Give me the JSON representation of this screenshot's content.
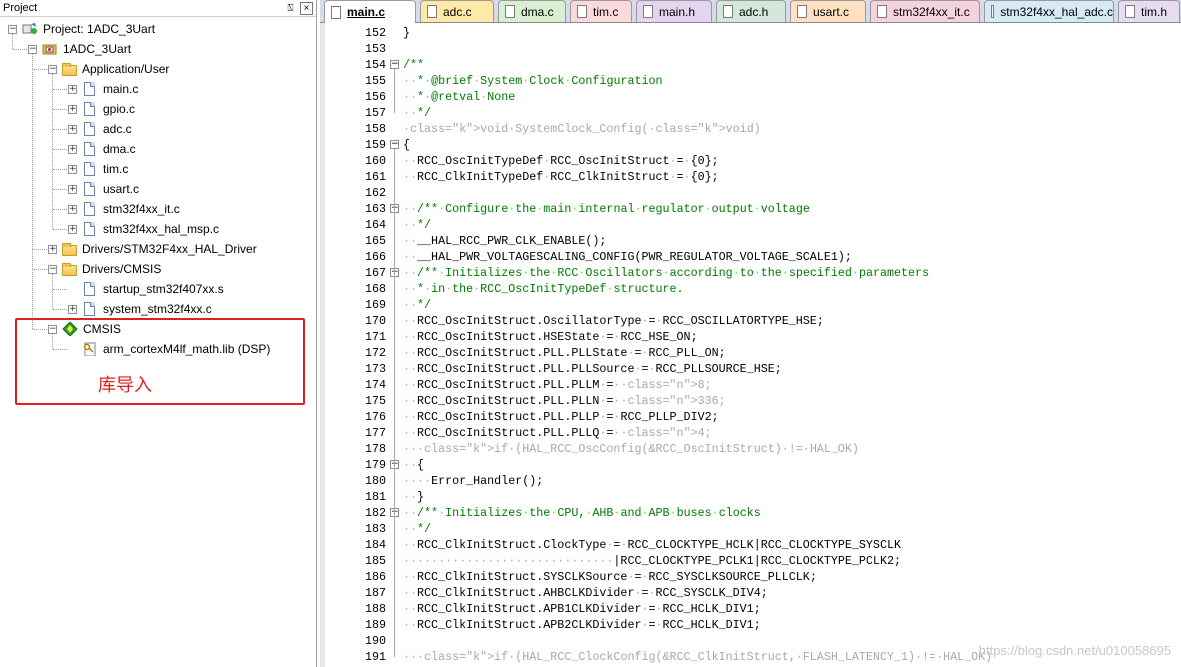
{
  "panel": {
    "title": "Project",
    "pin_glyph": "⍂",
    "close_glyph": "×"
  },
  "tree": [
    {
      "label": "Project: 1ADC_3Uart",
      "icon": "project-icon",
      "expander": "−",
      "depth": 0
    },
    {
      "label": "1ADC_3Uart",
      "icon": "target-icon",
      "expander": "−",
      "depth": 1
    },
    {
      "label": "Application/User",
      "icon": "folder-open-icon",
      "expander": "−",
      "depth": 2
    },
    {
      "label": "main.c",
      "icon": "file-icon",
      "expander": "+",
      "depth": 3
    },
    {
      "label": "gpio.c",
      "icon": "file-icon",
      "expander": "+",
      "depth": 3
    },
    {
      "label": "adc.c",
      "icon": "file-icon",
      "expander": "+",
      "depth": 3
    },
    {
      "label": "dma.c",
      "icon": "file-icon",
      "expander": "+",
      "depth": 3
    },
    {
      "label": "tim.c",
      "icon": "file-icon",
      "expander": "+",
      "depth": 3
    },
    {
      "label": "usart.c",
      "icon": "file-icon",
      "expander": "+",
      "depth": 3
    },
    {
      "label": "stm32f4xx_it.c",
      "icon": "file-icon",
      "expander": "+",
      "depth": 3
    },
    {
      "label": "stm32f4xx_hal_msp.c",
      "icon": "file-icon",
      "expander": "+",
      "depth": 3
    },
    {
      "label": "Drivers/STM32F4xx_HAL_Driver",
      "icon": "folder-icon",
      "expander": "+",
      "depth": 2
    },
    {
      "label": "Drivers/CMSIS",
      "icon": "folder-open-icon",
      "expander": "−",
      "depth": 2
    },
    {
      "label": "startup_stm32f407xx.s",
      "icon": "file-icon",
      "expander": "",
      "depth": 3
    },
    {
      "label": "system_stm32f4xx.c",
      "icon": "file-icon",
      "expander": "+",
      "depth": 3
    },
    {
      "label": "CMSIS",
      "icon": "component-icon",
      "expander": "−",
      "depth": 2
    },
    {
      "label": "arm_cortexM4lf_math.lib (DSP)",
      "icon": "key-icon",
      "expander": "",
      "depth": 3
    }
  ],
  "annotation": "库导入",
  "tabs": [
    {
      "label": "main.c",
      "color": "#ffffff",
      "active": true
    },
    {
      "label": "adc.c",
      "color": "#ffe9a8"
    },
    {
      "label": "dma.c",
      "color": "#d9efd2"
    },
    {
      "label": "tim.c",
      "color": "#fbd9dd"
    },
    {
      "label": "main.h",
      "color": "#e3d4f0"
    },
    {
      "label": "adc.h",
      "color": "#d3e8da"
    },
    {
      "label": "usart.c",
      "color": "#ffe0c0"
    },
    {
      "label": "stm32f4xx_it.c",
      "color": "#f6d3dc"
    },
    {
      "label": "stm32f4xx_hal_adc.c",
      "color": "#d5eaf4"
    },
    {
      "label": "tim.h",
      "color": "#e6dcf2"
    }
  ],
  "code_lines": [
    {
      "n": "152",
      "fold": "",
      "text": "}"
    },
    {
      "n": "153",
      "fold": "",
      "text": ""
    },
    {
      "n": "154",
      "fold": "−",
      "text": "/**"
    },
    {
      "n": "155",
      "fold": "",
      "text": "  * @brief System Clock Configuration"
    },
    {
      "n": "156",
      "fold": "",
      "text": "  * @retval None"
    },
    {
      "n": "157",
      "fold": "",
      "text": "  */"
    },
    {
      "n": "158",
      "fold": "",
      "text": "void SystemClock_Config(void)"
    },
    {
      "n": "159",
      "fold": "−",
      "text": "{"
    },
    {
      "n": "160",
      "fold": "",
      "text": "  RCC_OscInitTypeDef RCC_OscInitStruct = {0};"
    },
    {
      "n": "161",
      "fold": "",
      "text": "  RCC_ClkInitTypeDef RCC_ClkInitStruct = {0};"
    },
    {
      "n": "162",
      "fold": "",
      "text": ""
    },
    {
      "n": "163",
      "fold": "−",
      "text": "  /** Configure the main internal regulator output voltage"
    },
    {
      "n": "164",
      "fold": "",
      "text": "  */"
    },
    {
      "n": "165",
      "fold": "",
      "text": "  __HAL_RCC_PWR_CLK_ENABLE();"
    },
    {
      "n": "166",
      "fold": "",
      "text": "  __HAL_PWR_VOLTAGESCALING_CONFIG(PWR_REGULATOR_VOLTAGE_SCALE1);"
    },
    {
      "n": "167",
      "fold": "−",
      "text": "  /** Initializes the RCC Oscillators according to the specified parameters"
    },
    {
      "n": "168",
      "fold": "",
      "text": "  * in the RCC_OscInitTypeDef structure."
    },
    {
      "n": "169",
      "fold": "",
      "text": "  */"
    },
    {
      "n": "170",
      "fold": "",
      "text": "  RCC_OscInitStruct.OscillatorType = RCC_OSCILLATORTYPE_HSE;"
    },
    {
      "n": "171",
      "fold": "",
      "text": "  RCC_OscInitStruct.HSEState = RCC_HSE_ON;"
    },
    {
      "n": "172",
      "fold": "",
      "text": "  RCC_OscInitStruct.PLL.PLLState = RCC_PLL_ON;"
    },
    {
      "n": "173",
      "fold": "",
      "text": "  RCC_OscInitStruct.PLL.PLLSource = RCC_PLLSOURCE_HSE;"
    },
    {
      "n": "174",
      "fold": "",
      "text": "  RCC_OscInitStruct.PLL.PLLM = 8;"
    },
    {
      "n": "175",
      "fold": "",
      "text": "  RCC_OscInitStruct.PLL.PLLN = 336;"
    },
    {
      "n": "176",
      "fold": "",
      "text": "  RCC_OscInitStruct.PLL.PLLP = RCC_PLLP_DIV2;"
    },
    {
      "n": "177",
      "fold": "",
      "text": "  RCC_OscInitStruct.PLL.PLLQ = 4;"
    },
    {
      "n": "178",
      "fold": "",
      "text": "  if (HAL_RCC_OscConfig(&RCC_OscInitStruct) != HAL_OK)"
    },
    {
      "n": "179",
      "fold": "−",
      "text": "  {"
    },
    {
      "n": "180",
      "fold": "",
      "text": "    Error_Handler();"
    },
    {
      "n": "181",
      "fold": "",
      "text": "  }"
    },
    {
      "n": "182",
      "fold": "−",
      "text": "  /** Initializes the CPU, AHB and APB buses clocks"
    },
    {
      "n": "183",
      "fold": "",
      "text": "  */"
    },
    {
      "n": "184",
      "fold": "",
      "text": "  RCC_ClkInitStruct.ClockType = RCC_CLOCKTYPE_HCLK|RCC_CLOCKTYPE_SYSCLK"
    },
    {
      "n": "185",
      "fold": "",
      "text": "                              |RCC_CLOCKTYPE_PCLK1|RCC_CLOCKTYPE_PCLK2;"
    },
    {
      "n": "186",
      "fold": "",
      "text": "  RCC_ClkInitStruct.SYSCLKSource = RCC_SYSCLKSOURCE_PLLCLK;"
    },
    {
      "n": "187",
      "fold": "",
      "text": "  RCC_ClkInitStruct.AHBCLKDivider = RCC_SYSCLK_DIV4;"
    },
    {
      "n": "188",
      "fold": "",
      "text": "  RCC_ClkInitStruct.APB1CLKDivider = RCC_HCLK_DIV1;"
    },
    {
      "n": "189",
      "fold": "",
      "text": "  RCC_ClkInitStruct.APB2CLKDivider = RCC_HCLK_DIV1;"
    },
    {
      "n": "190",
      "fold": "",
      "text": ""
    },
    {
      "n": "191",
      "fold": "",
      "text": "  if (HAL_RCC_ClockConfig(&RCC_ClkInitStruct, FLASH_LATENCY_1) != HAL_OK)"
    }
  ],
  "watermark": "https://blog.csdn.net/u010058695"
}
